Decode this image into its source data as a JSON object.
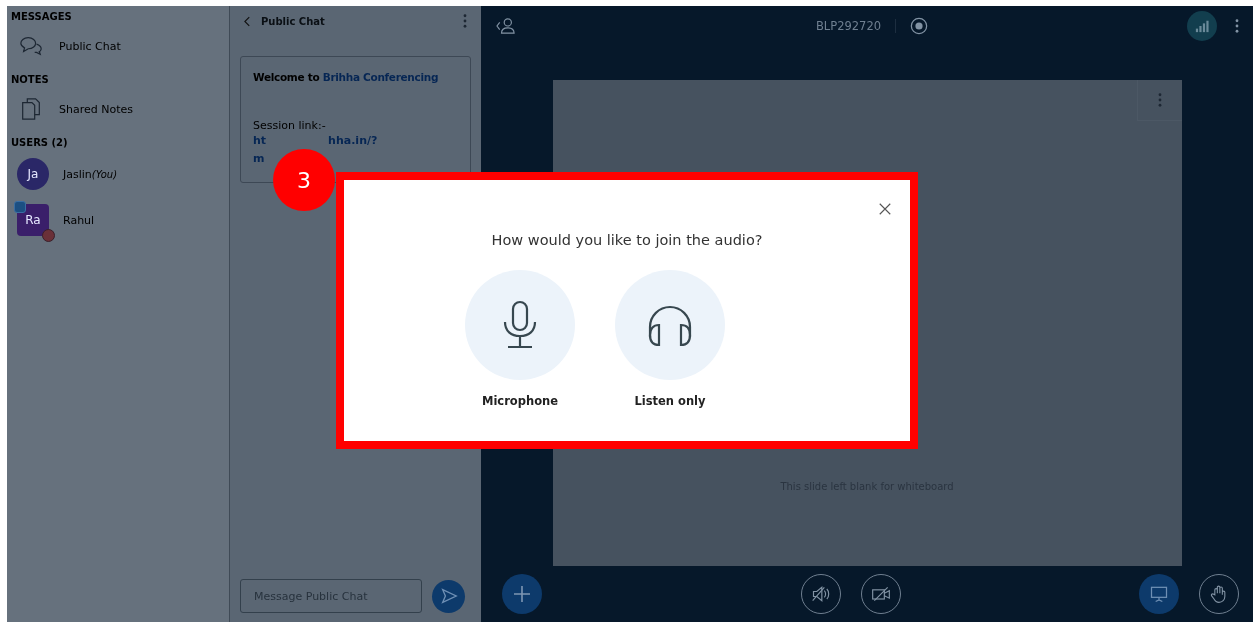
{
  "sidebar": {
    "sections": [
      {
        "heading": "MESSAGES",
        "items": [
          {
            "kind": "chat",
            "label": "Public Chat"
          }
        ]
      },
      {
        "heading": "NOTES",
        "items": [
          {
            "kind": "notes",
            "label": "Shared Notes"
          }
        ]
      }
    ],
    "users": {
      "heading": "USERS (2)",
      "list": [
        {
          "kind": "self",
          "initials": "Ja",
          "name": "Jaslin",
          "suffix": "(You)"
        },
        {
          "kind": "presenter",
          "initials": "Ra",
          "name": "Rahul"
        }
      ]
    }
  },
  "chat": {
    "title": "Public Chat",
    "welcome": "Welcome to",
    "brand": "Brihha Conferencing",
    "session_label": "Session link:-",
    "link_start": "ht",
    "link_end": "hha.in/?",
    "link_line_2": "m",
    "placeholder": "Message Public Chat"
  },
  "main": {
    "meeting_id": "BLP292720",
    "whiteboard_hint": "This slide left blank for whiteboard"
  },
  "modal": {
    "title": "How would you like to join the audio?",
    "options": [
      {
        "kind": "microphone",
        "label": "Microphone"
      },
      {
        "kind": "listen",
        "label": "Listen only"
      }
    ]
  },
  "step_badge": "3"
}
